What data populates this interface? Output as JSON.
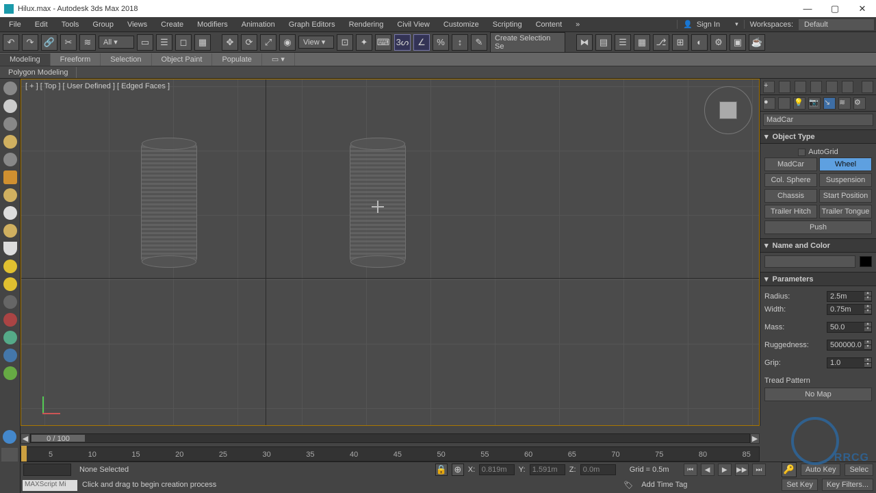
{
  "title": "Hilux.max - Autodesk 3ds Max 2018",
  "signin": "Sign In",
  "workspaces_label": "Workspaces:",
  "workspace": "Default",
  "menubar": [
    "File",
    "Edit",
    "Tools",
    "Group",
    "Views",
    "Create",
    "Modifiers",
    "Animation",
    "Graph Editors",
    "Rendering",
    "Civil View",
    "Customize",
    "Scripting",
    "Content"
  ],
  "toolbar": {
    "all": "All",
    "view": "View",
    "sel_set": "Create Selection Se"
  },
  "ribbon_tabs": [
    "Modeling",
    "Freeform",
    "Selection",
    "Object Paint",
    "Populate"
  ],
  "ribbon_sub": "Polygon Modeling",
  "viewport_label": "[ + ] [ Top ] [ User Defined ] [ Edged Faces ]",
  "rp_category": "MadCar",
  "object_type": {
    "title": "Object Type",
    "autogrid": "AutoGrid",
    "buttons": [
      "MadCar",
      "Wheel",
      "Col. Sphere",
      "Suspension",
      "Chassis",
      "Start Position",
      "Trailer Hitch",
      "Trailer Tongue",
      "Push"
    ],
    "selected": "Wheel"
  },
  "name_color": {
    "title": "Name and Color",
    "name": ""
  },
  "params": {
    "title": "Parameters",
    "radius": {
      "label": "Radius:",
      "value": "2.5m"
    },
    "width": {
      "label": "Width:",
      "value": "0.75m"
    },
    "mass": {
      "label": "Mass:",
      "value": "50.0"
    },
    "ruggedness": {
      "label": "Ruggedness:",
      "value": "500000.0"
    },
    "grip": {
      "label": "Grip:",
      "value": "1.0"
    },
    "tread": "Tread Pattern",
    "nomap": "No Map"
  },
  "slider": "0 / 100",
  "timeline_ticks": [
    "5",
    "10",
    "15",
    "20",
    "25",
    "30",
    "35",
    "40",
    "45",
    "50",
    "55",
    "60",
    "65",
    "70",
    "75",
    "80",
    "85"
  ],
  "status": {
    "sel": "None Selected",
    "hint": "Click and drag to begin creation process",
    "x_label": "X:",
    "x": "0.819m",
    "y_label": "Y:",
    "y": "1.591m",
    "z_label": "Z:",
    "z": "0.0m",
    "grid": "Grid = 0.5m",
    "addtime": "Add Time Tag",
    "autokey": "Auto Key",
    "setkey": "Set Key",
    "selec": "Selec",
    "keyfilt": "Key Filters...",
    "maxscript": "MAXScript Mi"
  }
}
